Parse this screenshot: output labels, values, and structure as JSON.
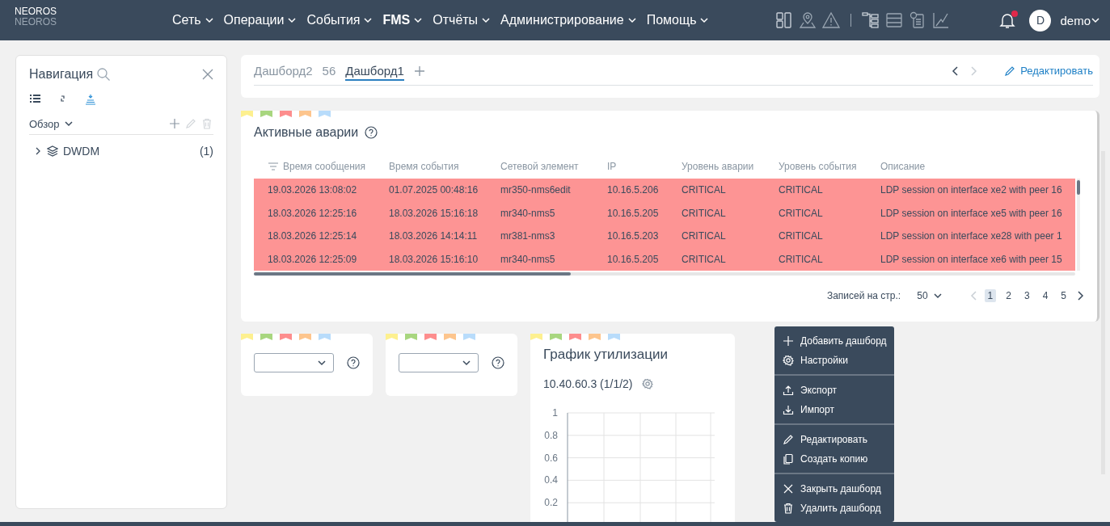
{
  "header": {
    "logo": "NEOROS",
    "logo_subtitle": "NEOROS",
    "menu": [
      {
        "label": "Сеть",
        "selected": false
      },
      {
        "label": "Операции",
        "selected": false
      },
      {
        "label": "События",
        "selected": false
      },
      {
        "label": "FMS",
        "selected": true
      },
      {
        "label": "Отчёты",
        "selected": false
      },
      {
        "label": "Администрирование",
        "selected": false
      },
      {
        "label": "Помощь",
        "selected": false
      }
    ],
    "notifications_unread": true,
    "user": {
      "avatar": "D",
      "name": "demo"
    }
  },
  "navigation": {
    "title": "Навигация",
    "views": [
      {
        "selected": false
      },
      {
        "selected": false
      },
      {
        "selected": true
      }
    ],
    "section": "Обзор",
    "actions": [
      {
        "kind": "add",
        "disabled": false
      },
      {
        "kind": "edit",
        "disabled": true
      },
      {
        "kind": "delete",
        "disabled": true
      }
    ],
    "tree": [
      {
        "label": "DWDM",
        "count": "(1)",
        "expanded": false
      }
    ]
  },
  "dashboard_tabs": {
    "tabs": [
      {
        "label": "Дашборд2",
        "selected": false
      },
      {
        "label": "56",
        "selected": false
      },
      {
        "label": "Дашборд1",
        "selected": true
      }
    ],
    "prev_disabled": false,
    "next_disabled": true,
    "edit_button": "Редактировать"
  },
  "alarms": {
    "title": "Активные аварии",
    "columns": [
      "Время сообщения",
      "Время события",
      "Сетевой элемент",
      "IP",
      "Уровень аварии",
      "Уровень события",
      "Описание"
    ],
    "rows": [
      {
        "color": "#fd9494",
        "cells": [
          "19.03.2026 13:08:02",
          "01.07.2025 00:48:16",
          "mr350-nms6edit",
          "10.16.5.206",
          "CRITICAL",
          "CRITICAL",
          "LDP session on interface xe2 with peer 16"
        ]
      },
      {
        "color": "#fd9494",
        "cells": [
          "18.03.2026 12:25:16",
          "18.03.2026 15:16:18",
          "mr340-nms5",
          "10.16.5.205",
          "CRITICAL",
          "CRITICAL",
          "LDP session on interface xe5 with peer 16"
        ]
      },
      {
        "color": "#fd9494",
        "cells": [
          "18.03.2026 12:25:14",
          "18.03.2026 14:14:11",
          "mr381-nms3",
          "10.16.5.203",
          "CRITICAL",
          "CRITICAL",
          "LDP session on interface xe28 with peer 1"
        ]
      },
      {
        "color": "#fd9494",
        "cells": [
          "18.03.2026 12:25:09",
          "18.03.2026 15:16:10",
          "mr340-nms5",
          "10.16.5.205",
          "CRITICAL",
          "CRITICAL",
          "LDP session on interface xe6 with peer 15"
        ]
      }
    ],
    "pagination": {
      "page_size_label": "Записей на стр.:",
      "page_size": "50",
      "prev_disabled": true,
      "pages": [
        {
          "label": "1",
          "selected": true
        },
        {
          "label": "2",
          "selected": false
        },
        {
          "label": "3",
          "selected": false
        },
        {
          "label": "4",
          "selected": false
        },
        {
          "label": "5",
          "selected": false
        }
      ]
    }
  },
  "widgets": [
    {
      "kind": "select"
    },
    {
      "kind": "select"
    },
    {
      "kind": "chart",
      "title": "График утилизации",
      "subtitle": "10.40.60.3 (1/1/2)",
      "y_axis_labels": [
        "1",
        "0.8",
        "0.6",
        "0.4",
        "0.2"
      ]
    }
  ],
  "context_menu": {
    "groups": [
      {
        "items": [
          {
            "kind": "add",
            "label": "Добавить дашборд"
          },
          {
            "kind": "settings",
            "label": "Настройки"
          }
        ]
      },
      {
        "items": [
          {
            "kind": "export",
            "label": "Экспорт"
          },
          {
            "kind": "import",
            "label": "Импорт"
          }
        ]
      },
      {
        "items": [
          {
            "kind": "edit",
            "label": "Редактировать"
          },
          {
            "kind": "copy",
            "label": "Создать копию"
          }
        ]
      },
      {
        "items": [
          {
            "kind": "close",
            "label": "Закрыть дашборд"
          },
          {
            "kind": "delete",
            "label": "Удалить дашборд"
          }
        ]
      }
    ]
  }
}
